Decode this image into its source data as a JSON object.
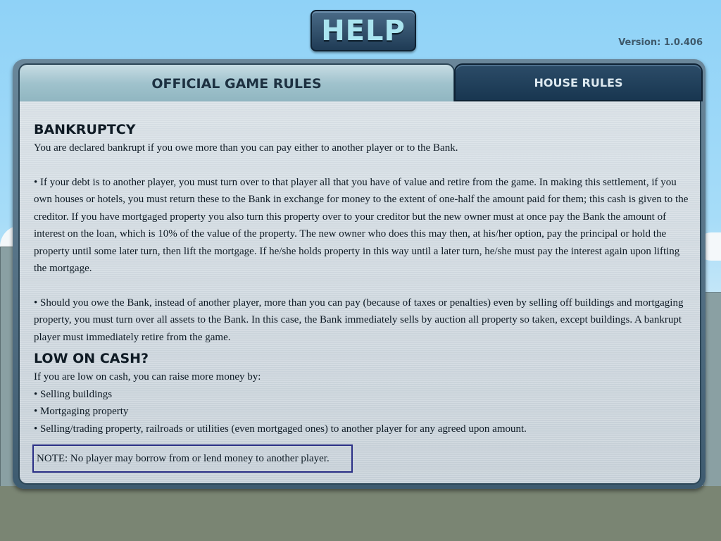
{
  "header": {
    "title": "HELP",
    "version": "Version: 1.0.406"
  },
  "tabs": {
    "official": "OFFICIAL GAME RULES",
    "house": "HOUSE RULES"
  },
  "bankruptcy": {
    "heading": "BANKRUPTCY",
    "intro": "You are declared bankrupt if you owe more than you can pay either to another player or to the Bank.",
    "p1": "• If your debt is to another player, you must turn over to that player all that you have of value and retire from the game.  In making this settlement, if you own houses or hotels, you must return these to the Bank in exchange for money to the extent of one-half the amount paid for them; this cash is given to the creditor.  If you have mortgaged property you also turn this property over to your creditor but the new owner must at once pay the Bank the amount of interest on the loan, which is 10% of the value of the property.  The new owner who does this may then, at his/her option, pay the principal or hold the property until some later turn, then lift the mortgage.  If he/she holds property in this way until a later turn, he/she must pay the interest again upon lifting the mortgage.",
    "p2": "• Should you owe the Bank, instead of another player, more than you can pay (because of taxes or penalties) even by selling off buildings and mortgaging property, you must turn over all assets to the Bank.  In this case, the Bank immediately sells by auction all property so taken, except buildings.  A bankrupt player must immediately retire from the game."
  },
  "low_cash": {
    "heading": "LOW ON CASH?",
    "intro": "If you are low on cash, you can raise more money by:",
    "items": [
      "• Selling buildings",
      "• Mortgaging property",
      "• Selling/trading property, railroads or utilities (even mortgaged ones) to another player for any agreed upon amount."
    ]
  },
  "note": "NOTE: No player may borrow from or lend money to another player."
}
